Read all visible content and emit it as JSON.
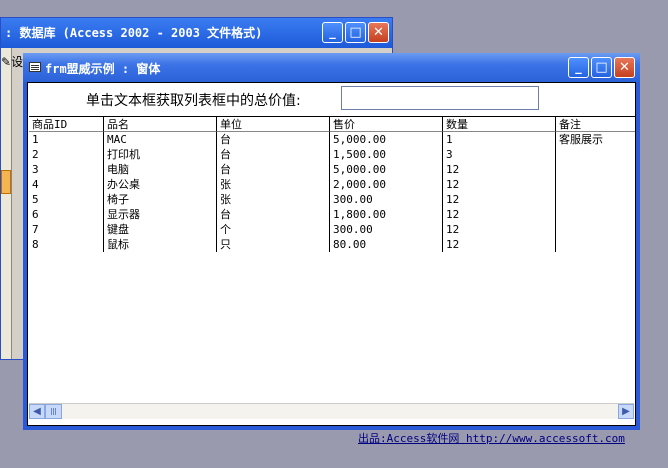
{
  "bg_window": {
    "title": ": 数据库 (Access 2002 - 2003 文件格式)",
    "toolbar_fragment": "设"
  },
  "form": {
    "title": "frm盟威示例 : 窗体",
    "prompt": "单击文本框获取列表框中的总价值:",
    "textbox_value": "",
    "listbox": {
      "columns": [
        "商品ID",
        "品名",
        "单位",
        "售价",
        "数量",
        "备注"
      ],
      "rows": [
        [
          "1",
          "MAC",
          "台",
          "5,000.00",
          "1",
          "客服展示"
        ],
        [
          "2",
          "打印机",
          "台",
          "1,500.00",
          "3",
          ""
        ],
        [
          "3",
          "电脑",
          "台",
          "5,000.00",
          "12",
          ""
        ],
        [
          "4",
          "办公桌",
          "张",
          "2,000.00",
          "12",
          ""
        ],
        [
          "5",
          "椅子",
          "张",
          "300.00",
          "12",
          ""
        ],
        [
          "6",
          "显示器",
          "台",
          "1,800.00",
          "12",
          ""
        ],
        [
          "7",
          "键盘",
          "个",
          "300.00",
          "12",
          ""
        ],
        [
          "8",
          "鼠标",
          "只",
          "80.00",
          "12",
          ""
        ]
      ]
    },
    "credit": {
      "label": "出品:Access软件网",
      "url": "http://www.accessoft.com"
    }
  },
  "icons": {
    "minimize": "minimize-icon",
    "maximize": "maximize-icon",
    "close": "close-icon"
  },
  "colors": {
    "titlebar": "#2c62d8",
    "desktop": "#9a9aae",
    "close_button": "#c4401e"
  }
}
